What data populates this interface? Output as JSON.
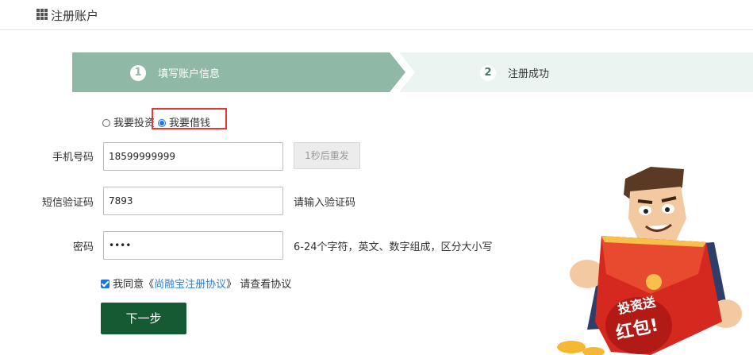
{
  "header": {
    "title": "注册账户",
    "icon": "grid-icon"
  },
  "steps": [
    {
      "num": "1",
      "label": "填写账户信息",
      "active": true
    },
    {
      "num": "2",
      "label": "注册成功",
      "active": false
    }
  ],
  "account_type": {
    "options": [
      {
        "label": "我要投资",
        "checked": false
      },
      {
        "label": "我要借钱",
        "checked": true
      }
    ]
  },
  "form": {
    "phone": {
      "label": "手机号码",
      "value": "18599999999",
      "send_button": "1秒后重发"
    },
    "sms": {
      "label": "短信验证码",
      "value": "7893",
      "hint": "请输入验证码"
    },
    "password": {
      "label": "密码",
      "value": "••••",
      "hint": "6-24个字符，英文、数字组成，区分大小写"
    }
  },
  "agreement": {
    "checked": true,
    "prefix": "我同意《",
    "link": "尚融宝注册协议",
    "suffix": "》 请查看协议"
  },
  "next_button": "下一步",
  "banner": {
    "text_top": "投资送",
    "text_bottom": "红包!"
  },
  "colors": {
    "step_active": "#8fb8a6",
    "step_inactive": "#ebf4f1",
    "primary_button": "#155a33",
    "highlight": "#e53935"
  }
}
